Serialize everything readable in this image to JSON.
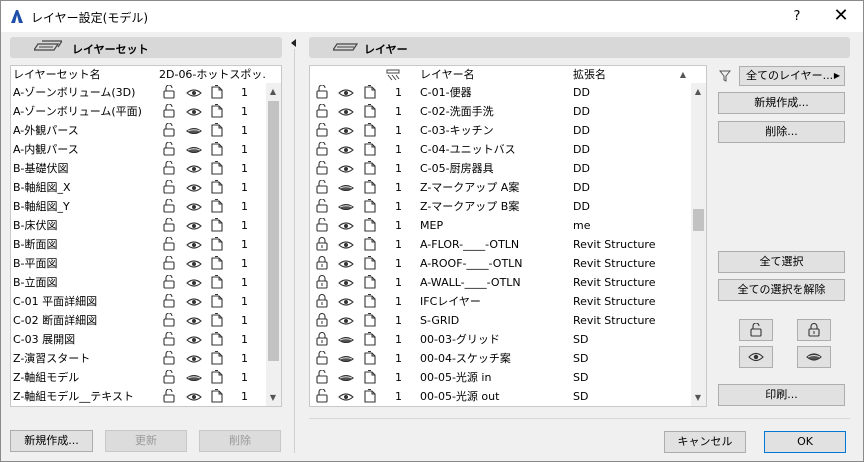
{
  "window": {
    "title": "レイヤー設定(モデル)",
    "help_label": "?",
    "close_label": "✕"
  },
  "left": {
    "header": "レイヤーセット",
    "col_name": "レイヤーセット名",
    "col_hotspot": "2D-06-ホットスポッ...",
    "rows": [
      {
        "name": "A-ゾーンボリューム(3D)",
        "eye": "open",
        "num": "1"
      },
      {
        "name": "A-ゾーンボリューム(平面)",
        "eye": "open",
        "num": "1"
      },
      {
        "name": "A-外観パース",
        "eye": "closed",
        "num": "1"
      },
      {
        "name": "A-内観パース",
        "eye": "closed",
        "num": "1"
      },
      {
        "name": "B-基礎伏図",
        "eye": "open",
        "num": "1"
      },
      {
        "name": "B-軸組図_X",
        "eye": "open",
        "num": "1"
      },
      {
        "name": "B-軸組図_Y",
        "eye": "open",
        "num": "1"
      },
      {
        "name": "B-床伏図",
        "eye": "open",
        "num": "1"
      },
      {
        "name": "B-断面図",
        "eye": "open",
        "num": "1"
      },
      {
        "name": "B-平面図",
        "eye": "open",
        "num": "1"
      },
      {
        "name": "B-立面図",
        "eye": "open",
        "num": "1"
      },
      {
        "name": "C-01 平面詳細図",
        "eye": "open",
        "num": "1"
      },
      {
        "name": "C-02 断面詳細図",
        "eye": "open",
        "num": "1"
      },
      {
        "name": "C-03 展開図",
        "eye": "open",
        "num": "1"
      },
      {
        "name": "Z-演習スタート",
        "eye": "open",
        "num": "1"
      },
      {
        "name": "Z-軸組モデル",
        "eye": "closed",
        "num": "1"
      },
      {
        "name": "Z-軸組モデル__テキスト",
        "eye": "open",
        "num": "1"
      }
    ],
    "buttons": {
      "new": "新規作成...",
      "update": "更新",
      "delete": "削除"
    }
  },
  "right": {
    "header": "レイヤー",
    "col_name": "レイヤー名",
    "col_ext": "拡張名",
    "rows": [
      {
        "lock": "unlocked",
        "eye": "open",
        "num": "1",
        "name": "C-01-便器",
        "ext": "DD"
      },
      {
        "lock": "unlocked",
        "eye": "open",
        "num": "1",
        "name": "C-02-洗面手洗",
        "ext": "DD"
      },
      {
        "lock": "unlocked",
        "eye": "open",
        "num": "1",
        "name": "C-03-キッチン",
        "ext": "DD"
      },
      {
        "lock": "unlocked",
        "eye": "open",
        "num": "1",
        "name": "C-04-ユニットバス",
        "ext": "DD"
      },
      {
        "lock": "unlocked",
        "eye": "open",
        "num": "1",
        "name": "C-05-厨房器具",
        "ext": "DD"
      },
      {
        "lock": "unlocked",
        "eye": "closed",
        "num": "1",
        "name": "Z-マークアップ A案",
        "ext": "DD"
      },
      {
        "lock": "unlocked",
        "eye": "closed",
        "num": "1",
        "name": "Z-マークアップ B案",
        "ext": "DD"
      },
      {
        "lock": "unlocked",
        "eye": "open",
        "num": "1",
        "name": "MEP",
        "ext": "me"
      },
      {
        "lock": "locked",
        "eye": "open",
        "num": "1",
        "name": "A-FLOR-____-OTLN",
        "ext": "Revit Structure"
      },
      {
        "lock": "locked",
        "eye": "open",
        "num": "1",
        "name": "A-ROOF-____-OTLN",
        "ext": "Revit Structure"
      },
      {
        "lock": "locked",
        "eye": "open",
        "num": "1",
        "name": "A-WALL-____-OTLN",
        "ext": "Revit Structure"
      },
      {
        "lock": "locked",
        "eye": "open",
        "num": "1",
        "name": "IFCレイヤー",
        "ext": "Revit Structure"
      },
      {
        "lock": "locked",
        "eye": "open",
        "num": "1",
        "name": "S-GRID",
        "ext": "Revit Structure"
      },
      {
        "lock": "locked",
        "eye": "closed",
        "num": "1",
        "name": "00-03-グリッド",
        "ext": "SD"
      },
      {
        "lock": "unlocked",
        "eye": "closed",
        "num": "1",
        "name": "00-04-スケッチ案",
        "ext": "SD"
      },
      {
        "lock": "unlocked",
        "eye": "closed",
        "num": "1",
        "name": "00-05-光源 in",
        "ext": "SD"
      },
      {
        "lock": "unlocked",
        "eye": "open",
        "num": "1",
        "name": "00-05-光源 out",
        "ext": "SD"
      }
    ]
  },
  "sidebar": {
    "filter": "全てのレイヤー...",
    "new": "新規作成...",
    "delete": "削除...",
    "select_all": "全て選択",
    "deselect_all": "全ての選択を解除",
    "print": "印刷..."
  },
  "footer": {
    "cancel": "キャンセル",
    "ok": "OK"
  }
}
